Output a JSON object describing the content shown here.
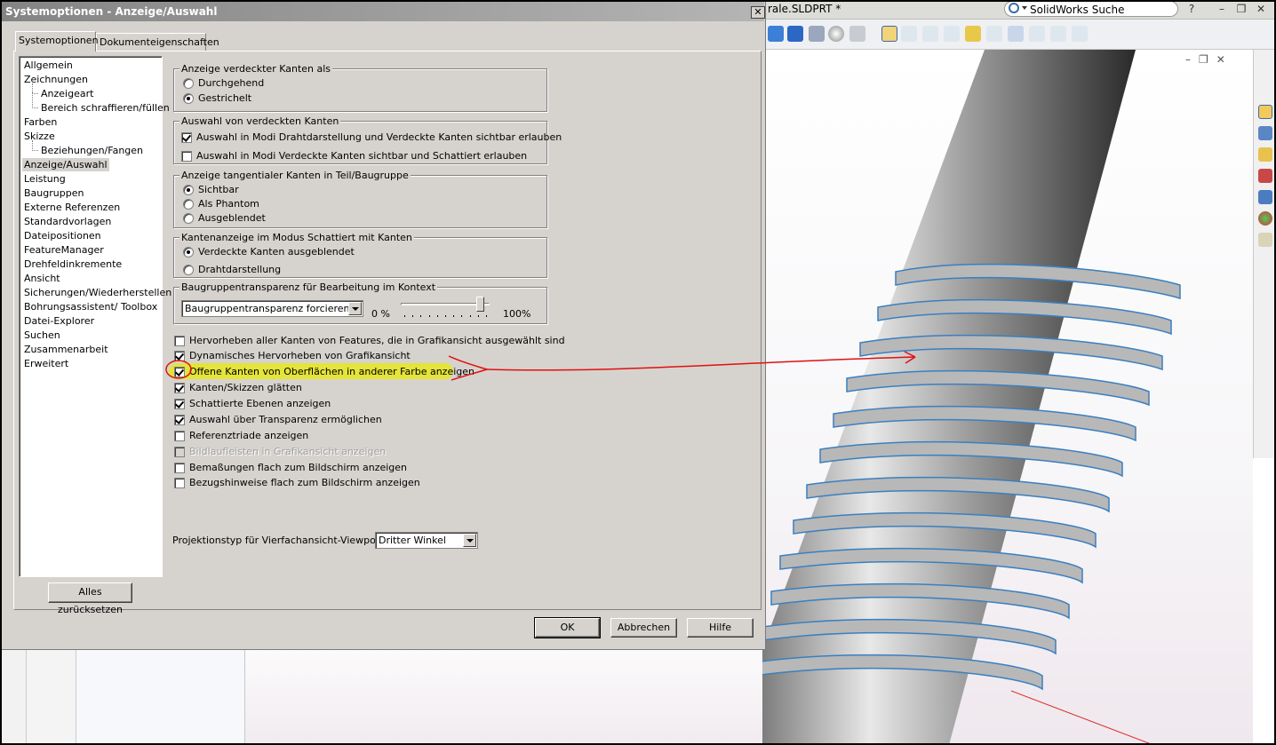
{
  "dialog": {
    "title": "Systemoptionen - Anzeige/Auswahl",
    "close": "✕",
    "tabs": [
      {
        "label": "Systemoptionen"
      },
      {
        "label": "Dokumenteigenschaften"
      }
    ],
    "tree": [
      {
        "label": "Allgemein"
      },
      {
        "label": "Zeichnungen"
      },
      {
        "label": "Anzeigeart"
      },
      {
        "label": "Bereich schraffieren/füllen"
      },
      {
        "label": "Farben"
      },
      {
        "label": "Skizze"
      },
      {
        "label": "Beziehungen/Fangen"
      },
      {
        "label": "Anzeige/Auswahl"
      },
      {
        "label": "Leistung"
      },
      {
        "label": "Baugruppen"
      },
      {
        "label": "Externe Referenzen"
      },
      {
        "label": "Standardvorlagen"
      },
      {
        "label": "Dateipositionen"
      },
      {
        "label": "FeatureManager"
      },
      {
        "label": "Drehfeldinkremente"
      },
      {
        "label": "Ansicht"
      },
      {
        "label": "Sicherungen/Wiederherstellen"
      },
      {
        "label": "Bohrungsassistent/ Toolbox"
      },
      {
        "label": "Datei-Explorer"
      },
      {
        "label": "Suchen"
      },
      {
        "label": "Zusammenarbeit"
      },
      {
        "label": "Erweitert"
      }
    ],
    "reset_label": "Alles zurücksetzen",
    "groups": {
      "hidden_edges": {
        "title": "Anzeige verdeckter Kanten als",
        "opt1": "Durchgehend",
        "opt2": "Gestrichelt"
      },
      "hidden_select": {
        "title": "Auswahl von verdeckten Kanten",
        "opt1": "Auswahl in Modi Drahtdarstellung und Verdeckte Kanten sichtbar erlauben",
        "opt2": "Auswahl in Modi Verdeckte Kanten sichtbar und Schattiert erlauben"
      },
      "tangent": {
        "title": "Anzeige tangentialer Kanten in Teil/Baugruppe",
        "opt1": "Sichtbar",
        "opt2": "Als Phantom",
        "opt3": "Ausgeblendet"
      },
      "shaded": {
        "title": "Kantenanzeige im Modus Schattiert mit Kanten",
        "opt1": "Verdeckte Kanten ausgeblendet",
        "opt2": "Drahtdarstellung"
      },
      "transparency": {
        "title": "Baugruppentransparenz für Bearbeitung im Kontext",
        "combo": "Baugruppentransparenz forcieren",
        "min": "0 %",
        "max": "100%",
        "slider_level": 0.9
      }
    },
    "checks": [
      {
        "label": "Hervorheben aller Kanten von Features, die in Grafikansicht ausgewählt sind",
        "checked": false
      },
      {
        "label": "Dynamisches Hervorheben von Grafikansicht",
        "checked": true
      },
      {
        "label": "Offene Kanten von Oberflächen in anderer Farbe anzeigen",
        "checked": true
      },
      {
        "label": "Kanten/Skizzen glätten",
        "checked": true
      },
      {
        "label": "Schattierte Ebenen anzeigen",
        "checked": true
      },
      {
        "label": "Auswahl über Transparenz ermöglichen",
        "checked": true
      },
      {
        "label": "Referenztriade anzeigen",
        "checked": false
      },
      {
        "label": "Bildlaufleisten in Grafikansicht anzeigen",
        "checked": false
      },
      {
        "label": "Bemaßungen flach zum Bildschirm anzeigen",
        "checked": false
      },
      {
        "label": "Bezugshinweise flach zum Bildschirm anzeigen",
        "checked": false
      }
    ],
    "projection": {
      "label": "Projektionstyp für Vierfachansicht-Viewport:",
      "value": "Dritter Winkel"
    },
    "buttons": {
      "ok": "OK",
      "cancel": "Abbrechen",
      "help": "Hilfe"
    }
  },
  "solidworks": {
    "doc_title": "rale.SLDPRT *",
    "search_label": "SolidWorks Suche",
    "help": "?",
    "minimize": "–",
    "restore": "❐",
    "close": "✕",
    "viewport_controls": "–❐✕"
  },
  "annotation": {
    "highlight_color": "#e6e62a",
    "arrow_color": "#e01010"
  }
}
